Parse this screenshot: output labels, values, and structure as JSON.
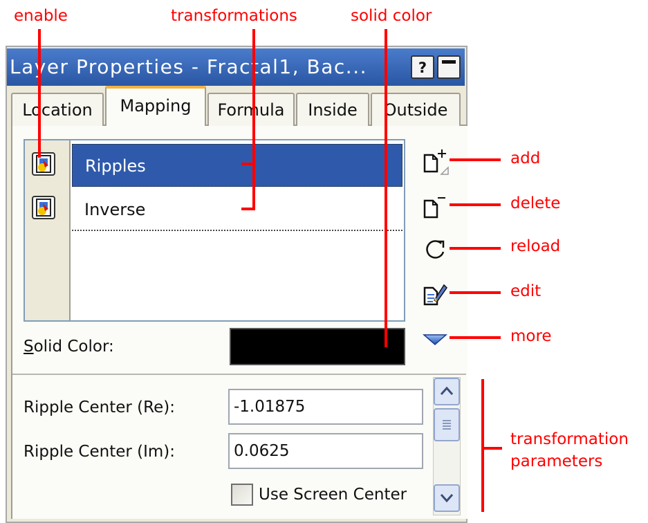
{
  "annotations": {
    "enable": "enable",
    "transformations": "transformations",
    "solid_color": "solid color",
    "add": "add",
    "delete": "delete",
    "reload": "reload",
    "edit": "edit",
    "more": "more",
    "transformation_parameters_line1": "transformation",
    "transformation_parameters_line2": "parameters",
    "color": "#ff0000"
  },
  "window": {
    "title": "Layer Properties - Fractal1, Bac...",
    "help_icon": "question-mark-icon",
    "minimize_icon": "minimize-icon"
  },
  "tabs": [
    {
      "label": "Location",
      "active": false
    },
    {
      "label": "Mapping",
      "active": true
    },
    {
      "label": "Formula",
      "active": false
    },
    {
      "label": "Inside",
      "active": false
    },
    {
      "label": "Outside",
      "active": false
    }
  ],
  "transformations": [
    {
      "label": "Ripples",
      "selected": true,
      "enabled": true
    },
    {
      "label": "Inverse",
      "selected": false,
      "enabled": true
    }
  ],
  "solid_color": {
    "label": "Solid Color:",
    "label_underline": "S",
    "label_rest": "olid Color:",
    "value": "#000000"
  },
  "side_tools": [
    {
      "name": "add",
      "icon": "add-page-icon"
    },
    {
      "name": "delete",
      "icon": "delete-page-icon"
    },
    {
      "name": "reload",
      "icon": "reload-icon"
    },
    {
      "name": "edit",
      "icon": "edit-icon"
    },
    {
      "name": "more",
      "icon": "triangle-down-icon"
    }
  ],
  "parameters": {
    "ripple_center_re": {
      "label": "Ripple Center (Re):",
      "value": "-1.01875"
    },
    "ripple_center_im": {
      "label": "Ripple Center (Im):",
      "value": "0.0625"
    },
    "use_screen_center": {
      "label": "Use Screen Center",
      "checked": false
    }
  },
  "colors": {
    "selection": "#2f5aab",
    "titlebar": "#2f5fad",
    "tab_highlight": "#f2b241"
  }
}
